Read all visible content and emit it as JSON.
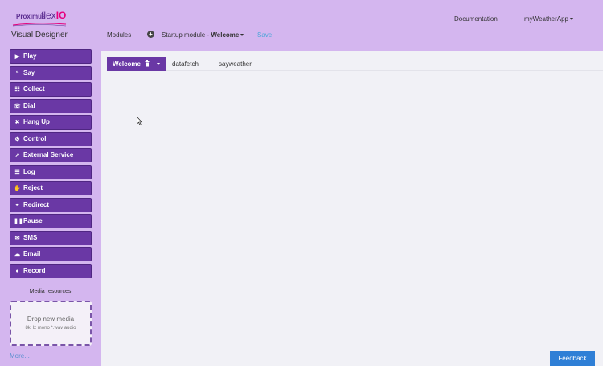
{
  "header": {
    "logo_brand": "Proximus",
    "logo_product_prefix": "flex",
    "logo_product_suffix": "IO",
    "app_title": "Visual Designer",
    "documentation_label": "Documentation",
    "app_menu_label": "myWeatherApp",
    "modules_label": "Modules",
    "startup_prefix": "Startup module - ",
    "startup_value": "Welcome",
    "save_label": "Save"
  },
  "sidebar": {
    "tools": [
      {
        "label": "Play",
        "icon": "play-icon",
        "glyph": "▶"
      },
      {
        "label": "Say",
        "icon": "quote-icon",
        "glyph": "❝"
      },
      {
        "label": "Collect",
        "icon": "grid-icon",
        "glyph": "☷"
      },
      {
        "label": "Dial",
        "icon": "phone-icon",
        "glyph": "☏"
      },
      {
        "label": "Hang Up",
        "icon": "x-icon",
        "glyph": "✖"
      },
      {
        "label": "Control",
        "icon": "cogs-icon",
        "glyph": "⚙"
      },
      {
        "label": "External Service",
        "icon": "external-link-icon",
        "glyph": "↗"
      },
      {
        "label": "Log",
        "icon": "list-icon",
        "glyph": "☰"
      },
      {
        "label": "Reject",
        "icon": "thumbs-down-icon",
        "glyph": "✋"
      },
      {
        "label": "Redirect",
        "icon": "link-icon",
        "glyph": "⚭"
      },
      {
        "label": "Pause",
        "icon": "pause-icon",
        "glyph": "❚❚"
      },
      {
        "label": "SMS",
        "icon": "envelope-icon",
        "glyph": "✉"
      },
      {
        "label": "Email",
        "icon": "comment-icon",
        "glyph": "☁"
      },
      {
        "label": "Record",
        "icon": "microphone-icon",
        "glyph": "●"
      }
    ],
    "media_title": "Media resources",
    "drop_title": "Drop new media",
    "drop_hint": "8kHz mono *.wav audio",
    "more_label": "More..."
  },
  "tabs": [
    {
      "label": "Welcome"
    },
    {
      "label": "datafetch"
    },
    {
      "label": "sayweather"
    }
  ],
  "feedback_label": "Feedback",
  "colors": {
    "header_bg": "#d4b6ef",
    "tool_bg": "#6a38a5",
    "feedback_bg": "#2f7fd6",
    "save_link": "#4aa6d9"
  }
}
